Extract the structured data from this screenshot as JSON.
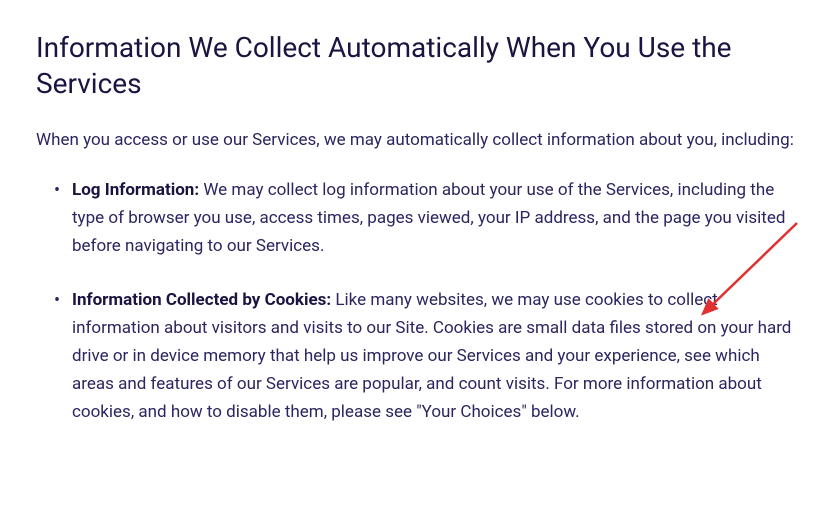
{
  "heading": "Information We Collect Automatically When You Use the Services",
  "intro": "When you access or use our Services, we may automatically collect information about you, including:",
  "items": [
    {
      "label": "Log Information:",
      "text": " We may collect log information about your use of the Services, including the type of browser you use, access times, pages viewed, your IP address, and the page you visited before navigating to our Services."
    },
    {
      "label": "Information Collected by Cookies:",
      "text": " Like many websites, we may use cookies to collect information about visitors and visits to our Site. Cookies are small data files stored on your hard drive or in device memory that help us improve our Services and your experience, see which areas and features of our Services are popular, and count visits. For more information about cookies, and how to disable them, please see \"Your Choices\" below."
    }
  ]
}
